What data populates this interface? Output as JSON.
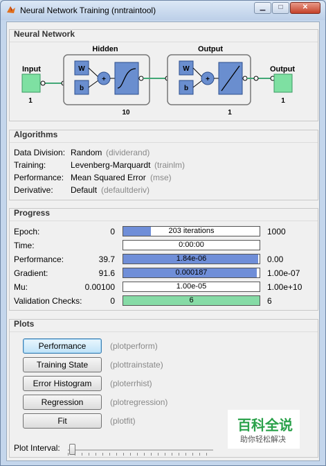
{
  "window": {
    "title": "Neural Network Training (nntraintool)",
    "minimize_glyph": "▁",
    "maximize_glyph": "□",
    "close_glyph": "✕",
    "icon": "matlab-icon"
  },
  "network": {
    "section_title": "Neural Network",
    "input_label": "Input",
    "input_size": "1",
    "hidden_label": "Hidden",
    "hidden_size": "10",
    "output_layer_label": "Output",
    "output_layer_size": "1",
    "output_label": "Output",
    "output_size": "1",
    "w_label": "W",
    "b_label": "b",
    "plus_label": "+",
    "colors": {
      "block": "#6a8ecf",
      "input": "#7ee0a2",
      "line": "#42a776"
    }
  },
  "algorithms": {
    "section_title": "Algorithms",
    "rows": [
      {
        "label": "Data Division:",
        "value": "Random",
        "fn": "(dividerand)"
      },
      {
        "label": "Training:",
        "value": "Levenberg-Marquardt",
        "fn": "(trainlm)"
      },
      {
        "label": "Performance:",
        "value": "Mean Squared Error",
        "fn": "(mse)"
      },
      {
        "label": "Derivative:",
        "value": "Default",
        "fn": "(defaultderiv)"
      }
    ]
  },
  "progress": {
    "section_title": "Progress",
    "rows": [
      {
        "label": "Epoch:",
        "start": "0",
        "bar_text": "203 iterations",
        "end": "1000",
        "fill": 0.203,
        "color": "blue"
      },
      {
        "label": "Time:",
        "start": "",
        "bar_text": "0:00:00",
        "end": "",
        "fill": 0,
        "color": "blue"
      },
      {
        "label": "Performance:",
        "start": "39.7",
        "bar_text": "1.84e-06",
        "end": "0.00",
        "fill": 0.99,
        "color": "blue"
      },
      {
        "label": "Gradient:",
        "start": "91.6",
        "bar_text": "0.000187",
        "end": "1.00e-07",
        "fill": 0.98,
        "color": "blue"
      },
      {
        "label": "Mu:",
        "start": "0.00100",
        "bar_text": "1.00e-05",
        "end": "1.00e+10",
        "fill": 0,
        "color": "blue"
      },
      {
        "label": "Validation Checks:",
        "start": "0",
        "bar_text": "6",
        "end": "6",
        "fill": 1.0,
        "color": "green"
      }
    ]
  },
  "plots": {
    "section_title": "Plots",
    "buttons": [
      {
        "label": "Performance",
        "fn": "(plotperform)"
      },
      {
        "label": "Training State",
        "fn": "(plottrainstate)"
      },
      {
        "label": "Error Histogram",
        "fn": "(ploterrhist)"
      },
      {
        "label": "Regression",
        "fn": "(plotregression)"
      },
      {
        "label": "Fit",
        "fn": "(plotfit)"
      }
    ],
    "interval_label": "Plot Interval:"
  },
  "watermark": {
    "main": "百科全说",
    "sub": "助你轻松解决"
  }
}
